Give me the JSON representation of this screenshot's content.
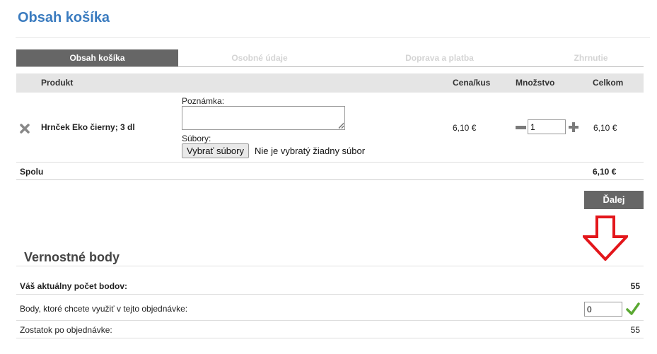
{
  "page": {
    "title": "Obsah košíka"
  },
  "steps": [
    {
      "label": "Obsah košíka",
      "active": true
    },
    {
      "label": "Osobné údaje",
      "active": false
    },
    {
      "label": "Doprava a platba",
      "active": false
    },
    {
      "label": "Zhrnutie",
      "active": false
    }
  ],
  "table": {
    "headers": {
      "product": "Produkt",
      "unit_price": "Cena/kus",
      "quantity": "Množstvo",
      "total": "Celkom"
    }
  },
  "item": {
    "name": "Hrnček Eko čierny; 3 dl",
    "note_label": "Poznámka:",
    "note_value": "",
    "files_label": "Súbory:",
    "file_button": "Vybrať súbory",
    "file_status": "Nie je vybratý žiadny súbor",
    "unit_price": "6,10 €",
    "quantity": "1",
    "total": "6,10 €",
    "remove_icon": "remove-x-icon",
    "minus_icon": "minus-icon",
    "plus_icon": "plus-icon"
  },
  "summary": {
    "label": "Spolu",
    "value": "6,10 €"
  },
  "next_button": "Ďalej",
  "annotation": {
    "icon": "red-down-arrow",
    "color": "#e3161b"
  },
  "loyalty": {
    "title": "Vernostné body",
    "current_label": "Váš aktuálny počet bodov:",
    "current_value": "55",
    "use_label": "Body, ktoré chcete využiť v tejto objednávke:",
    "use_value": "0",
    "confirm_icon": "checkmark-icon",
    "remaining_label": "Zostatok po objednávke:",
    "remaining_value": "55"
  },
  "colors": {
    "accent": "#3a7bbf",
    "active_tab": "#666666",
    "confirm": "#5aa832"
  }
}
